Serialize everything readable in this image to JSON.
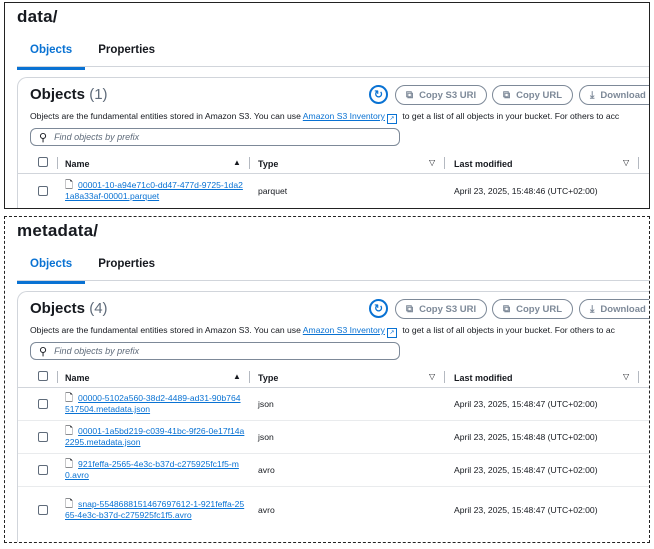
{
  "panels": [
    {
      "folder": "data/",
      "tabs": [
        "Objects",
        "Properties"
      ],
      "card_title": "Objects",
      "count": "(1)",
      "buttons": {
        "copy_s3_uri": "Copy S3 URI",
        "copy_url": "Copy URL",
        "download": "Download"
      },
      "description": {
        "before": "Objects are the fundamental entities stored in Amazon S3. You can use ",
        "link": "Amazon S3 Inventory",
        "after": " to get a list of all objects in your bucket. For others to acc"
      },
      "search_placeholder": "Find objects by prefix",
      "columns": [
        "Name",
        "Type",
        "Last modified"
      ],
      "rows": [
        {
          "name": "00001-10-a94e71c0-dd47-477d-9725-1da21a8a33af-00001.parquet",
          "type": "parquet",
          "modified": "April 23, 2025, 15:48:46 (UTC+02:00)"
        }
      ]
    },
    {
      "folder": "metadata/",
      "tabs": [
        "Objects",
        "Properties"
      ],
      "card_title": "Objects",
      "count": "(4)",
      "buttons": {
        "copy_s3_uri": "Copy S3 URI",
        "copy_url": "Copy URL",
        "download": "Download"
      },
      "description": {
        "before": "Objects are the fundamental entities stored in Amazon S3. You can use ",
        "link": "Amazon S3 Inventory",
        "after": " to get a list of all objects in your bucket. For others to ac"
      },
      "search_placeholder": "Find objects by prefix",
      "columns": [
        "Name",
        "Type",
        "Last modified"
      ],
      "rows": [
        {
          "name": "00000-5102a560-38d2-4489-ad31-90b764517504.metadata.json",
          "type": "json",
          "modified": "April 23, 2025, 15:48:47 (UTC+02:00)"
        },
        {
          "name": "00001-1a5bd219-c039-41bc-9f26-0e17f14a2295.metadata.json",
          "type": "json",
          "modified": "April 23, 2025, 15:48:48 (UTC+02:00)"
        },
        {
          "name": "921feffa-2565-4e3c-b37d-c275925fc1f5-m0.avro",
          "type": "avro",
          "modified": "April 23, 2025, 15:48:47 (UTC+02:00)"
        },
        {
          "name": "snap-5548688151467697612-1-921feffa-2565-4e3c-b37d-c275925fc1f5.avro",
          "type": "avro",
          "modified": "April 23, 2025, 15:48:47 (UTC+02:00)"
        }
      ]
    }
  ],
  "icons": {
    "refresh": "refresh-icon",
    "copy": "copy-icon",
    "download": "download-icon",
    "search": "search-icon",
    "file": "file-icon",
    "external": "external-link-icon",
    "sort": "sort-icon"
  },
  "colors": {
    "accent": "#0972d3",
    "text": "#16191f",
    "muted": "#5f6b7a",
    "border": "#d1d5db",
    "disabled": "#7d8998"
  }
}
